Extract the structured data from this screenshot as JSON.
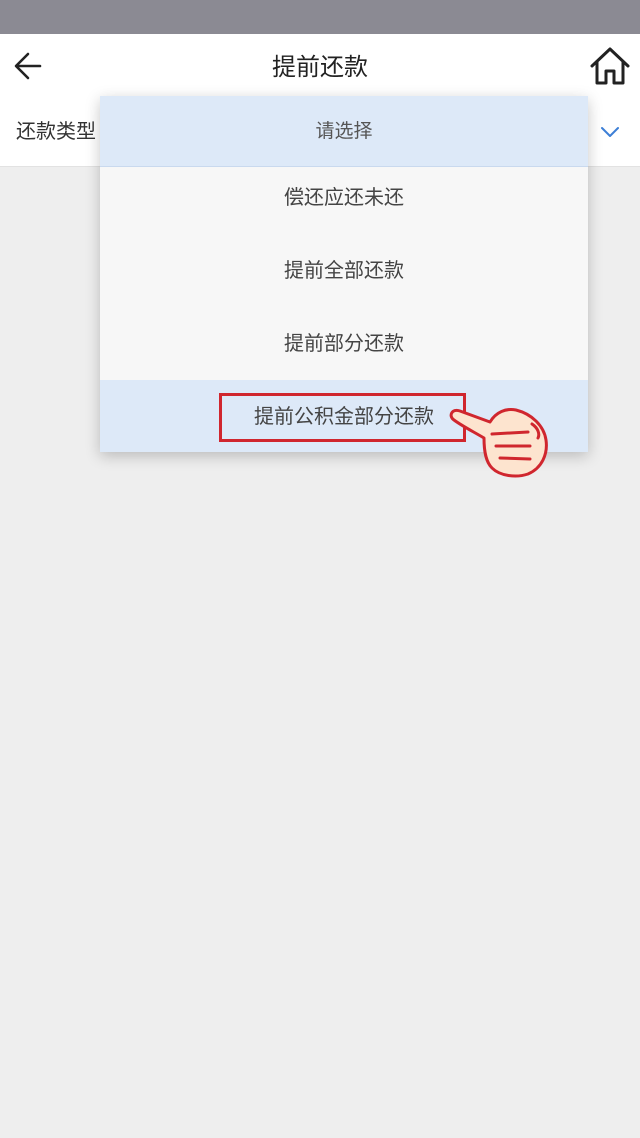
{
  "header": {
    "title": "提前还款",
    "back_icon": "arrow-left-icon",
    "home_icon": "home-icon"
  },
  "form": {
    "repayment_type_label": "还款类型",
    "chevron_icon": "chevron-down-icon"
  },
  "dropdown": {
    "placeholder": "请选择",
    "options": [
      {
        "label": "偿还应还未还"
      },
      {
        "label": "提前全部还款"
      },
      {
        "label": "提前部分还款"
      },
      {
        "label": "提前公积金部分还款",
        "selected": true
      }
    ]
  },
  "annotation": {
    "highlight_color": "#d0262e",
    "pointer_icon": "pointing-hand-icon"
  },
  "colors": {
    "status_bar": "#8b8a93",
    "accent": "#3d7fd6",
    "selected_bg": "#dde9f8",
    "page_bg": "#eeeeee"
  }
}
